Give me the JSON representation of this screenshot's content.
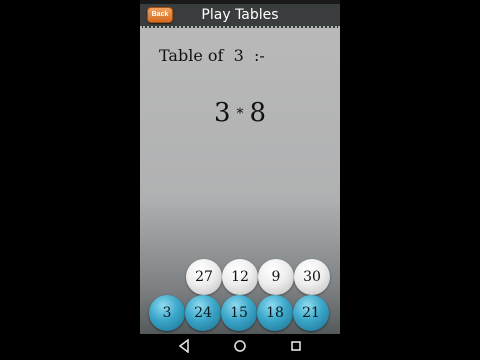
{
  "app": {
    "title": "Play Tables",
    "back_label": "Back"
  },
  "prompt": {
    "label": "Table of  3  :-",
    "multiplicand": "3",
    "operator": "*",
    "multiplier": "8"
  },
  "options_top": [
    "27",
    "12",
    "9",
    "30"
  ],
  "options_bottom": [
    "3",
    "24",
    "15",
    "18",
    "21"
  ],
  "nav": {
    "back_icon": "triangle-back-icon",
    "home_icon": "circle-home-icon",
    "recents_icon": "square-recents-icon"
  },
  "colors": {
    "back_button": "#e07f36",
    "option_blue": "#3aa6c9",
    "option_white": "#eeeeee"
  }
}
